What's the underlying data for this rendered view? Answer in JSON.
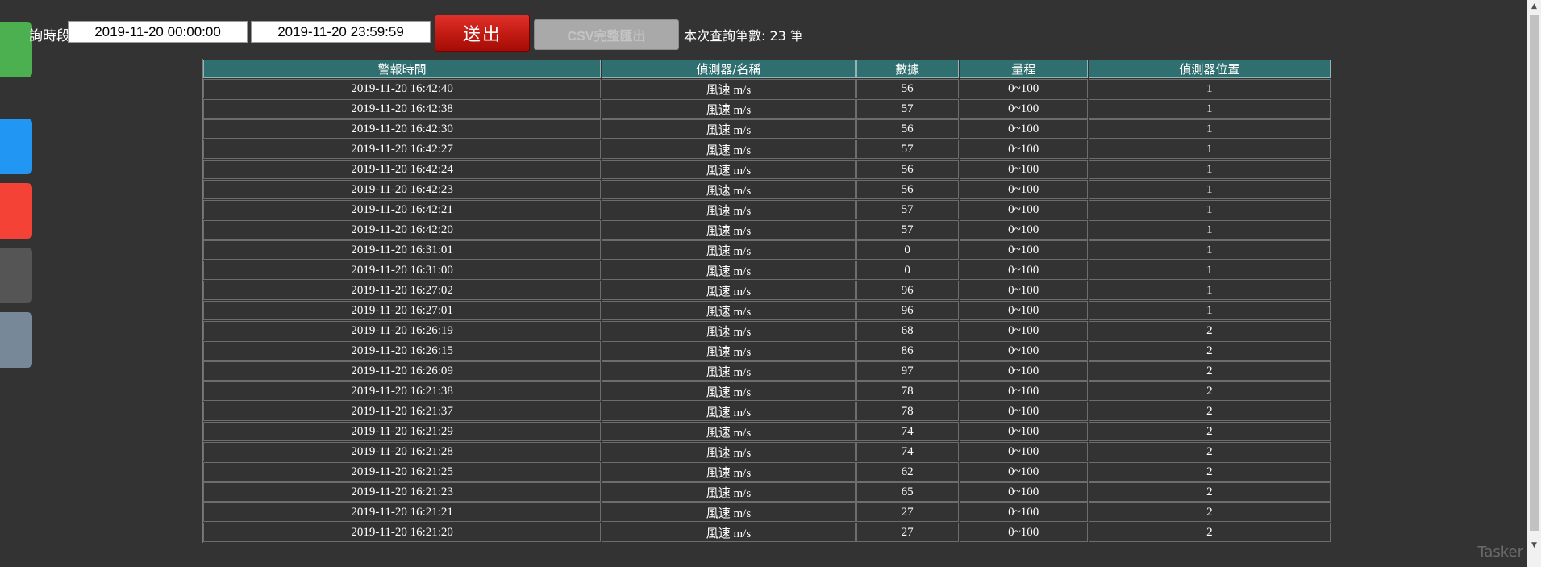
{
  "toolbar": {
    "range_label": "詢時段",
    "start_value": "2019-11-20 00:00:00",
    "end_value": "2019-11-20 23:59:59",
    "submit_label": "送出",
    "csv_label": "CSV完整匯出",
    "count_text": "本次查詢筆數: 23 筆"
  },
  "table": {
    "headers": [
      "警報時間",
      "偵測器/名稱",
      "數據",
      "量程",
      "偵測器位置"
    ],
    "rows": [
      [
        "2019-11-20 16:42:40",
        "風速 m/s",
        "56",
        "0~100",
        "1"
      ],
      [
        "2019-11-20 16:42:38",
        "風速 m/s",
        "57",
        "0~100",
        "1"
      ],
      [
        "2019-11-20 16:42:30",
        "風速 m/s",
        "56",
        "0~100",
        "1"
      ],
      [
        "2019-11-20 16:42:27",
        "風速 m/s",
        "57",
        "0~100",
        "1"
      ],
      [
        "2019-11-20 16:42:24",
        "風速 m/s",
        "56",
        "0~100",
        "1"
      ],
      [
        "2019-11-20 16:42:23",
        "風速 m/s",
        "56",
        "0~100",
        "1"
      ],
      [
        "2019-11-20 16:42:21",
        "風速 m/s",
        "57",
        "0~100",
        "1"
      ],
      [
        "2019-11-20 16:42:20",
        "風速 m/s",
        "57",
        "0~100",
        "1"
      ],
      [
        "2019-11-20 16:31:01",
        "風速 m/s",
        "0",
        "0~100",
        "1"
      ],
      [
        "2019-11-20 16:31:00",
        "風速 m/s",
        "0",
        "0~100",
        "1"
      ],
      [
        "2019-11-20 16:27:02",
        "風速 m/s",
        "96",
        "0~100",
        "1"
      ],
      [
        "2019-11-20 16:27:01",
        "風速 m/s",
        "96",
        "0~100",
        "1"
      ],
      [
        "2019-11-20 16:26:19",
        "風速 m/s",
        "68",
        "0~100",
        "2"
      ],
      [
        "2019-11-20 16:26:15",
        "風速 m/s",
        "86",
        "0~100",
        "2"
      ],
      [
        "2019-11-20 16:26:09",
        "風速 m/s",
        "97",
        "0~100",
        "2"
      ],
      [
        "2019-11-20 16:21:38",
        "風速 m/s",
        "78",
        "0~100",
        "2"
      ],
      [
        "2019-11-20 16:21:37",
        "風速 m/s",
        "78",
        "0~100",
        "2"
      ],
      [
        "2019-11-20 16:21:29",
        "風速 m/s",
        "74",
        "0~100",
        "2"
      ],
      [
        "2019-11-20 16:21:28",
        "風速 m/s",
        "74",
        "0~100",
        "2"
      ],
      [
        "2019-11-20 16:21:25",
        "風速 m/s",
        "62",
        "0~100",
        "2"
      ],
      [
        "2019-11-20 16:21:23",
        "風速 m/s",
        "65",
        "0~100",
        "2"
      ],
      [
        "2019-11-20 16:21:21",
        "風速 m/s",
        "27",
        "0~100",
        "2"
      ],
      [
        "2019-11-20 16:21:20",
        "風速 m/s",
        "27",
        "0~100",
        "2"
      ]
    ]
  },
  "side_tabs": [
    {
      "color": "#4caf50"
    },
    {
      "color": "#2196f3"
    },
    {
      "color": "#f44336"
    },
    {
      "color": "#555555"
    },
    {
      "color": "#778899"
    }
  ],
  "watermark": "Tasker",
  "colors": {
    "background": "#333333",
    "header_bg": "#2f6f6f",
    "submit_bg": "#c01a12",
    "csv_disabled_bg": "#a9a9a9"
  }
}
